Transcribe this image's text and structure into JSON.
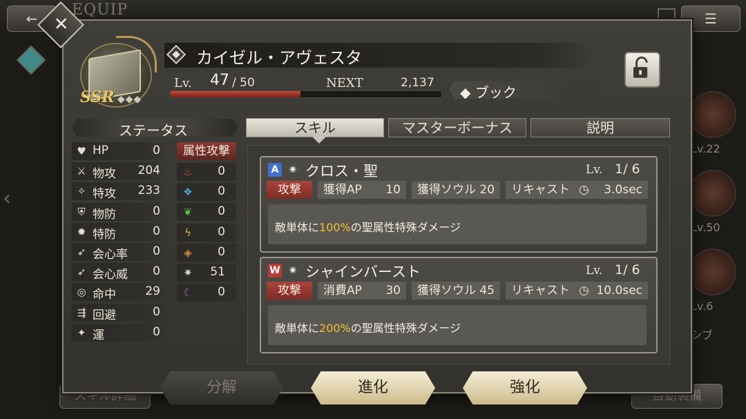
{
  "background": {
    "screen_title": "EQUIP",
    "side_texts": [
      "Lv.22",
      "Lv.50",
      "Lv.6",
      "シブ"
    ],
    "bottom_left_button": "スキル詳細",
    "bottom_right_button": "自動装備"
  },
  "header": {
    "name": "カイゼル・アヴェスタ",
    "rarity": "SSR",
    "rarity_dots": "◆◆◆",
    "level_label": "Lv.",
    "level_current": "47",
    "level_max": "/ 50",
    "next_label": "NEXT",
    "next_value": "2,137",
    "xp_fraction": 0.48,
    "equip_type": "◆ ブック"
  },
  "status": {
    "title": "ステータス",
    "stats": [
      {
        "icon": "heart-icon",
        "glyph": "♥",
        "label": "HP",
        "value": "0"
      },
      {
        "icon": "sword-icon",
        "glyph": "⚔",
        "label": "物攻",
        "value": "204"
      },
      {
        "icon": "staff-icon",
        "glyph": "✧",
        "label": "特攻",
        "value": "233"
      },
      {
        "icon": "shield-icon",
        "glyph": "⛨",
        "label": "物防",
        "value": "0"
      },
      {
        "icon": "gear-shield-icon",
        "glyph": "✹",
        "label": "特防",
        "value": "0"
      },
      {
        "icon": "crit-rate-icon",
        "glyph": "➶",
        "label": "会心率",
        "value": "0"
      },
      {
        "icon": "crit-damage-icon",
        "glyph": "➶",
        "label": "会心威",
        "value": "0"
      },
      {
        "icon": "target-icon",
        "glyph": "◎",
        "label": "命中",
        "value": "29"
      },
      {
        "icon": "boot-icon",
        "glyph": "⇶",
        "label": "回避",
        "value": "0"
      },
      {
        "icon": "luck-icon",
        "glyph": "✦",
        "label": "運",
        "value": "0"
      }
    ],
    "element_title": "属性攻撃",
    "elements": [
      {
        "icon": "fire-icon",
        "glyph": "♨",
        "color": "#d9533b",
        "value": "0"
      },
      {
        "icon": "water-icon",
        "glyph": "❖",
        "color": "#4fa3d9",
        "value": "0"
      },
      {
        "icon": "wind-icon",
        "glyph": "❦",
        "color": "#5fbf4a",
        "value": "0"
      },
      {
        "icon": "thunder-icon",
        "glyph": "ϟ",
        "color": "#e0b43a",
        "value": "0"
      },
      {
        "icon": "earth-icon",
        "glyph": "◈",
        "color": "#d88a3c",
        "value": "0"
      },
      {
        "icon": "light-icon",
        "glyph": "✷",
        "color": "#d8e0e8",
        "value": "51"
      },
      {
        "icon": "dark-icon",
        "glyph": "☾",
        "color": "#9b6ad8",
        "value": "0"
      }
    ]
  },
  "tabs": [
    {
      "label": "スキル",
      "active": true
    },
    {
      "label": "マスターボーナス",
      "active": false
    },
    {
      "label": "説明",
      "active": false
    }
  ],
  "skills": [
    {
      "badge": "A",
      "badge_color": "#3f6fd0",
      "name": "クロス・聖",
      "lv_label": "Lv.",
      "lv_value": "1/  6",
      "type": "攻撃",
      "ap_label": "獲得AP",
      "ap_value": "10",
      "soul_label": "獲得ソウル",
      "soul_value": "20",
      "recast_label": "リキャスト",
      "recast_value": "3.0sec",
      "desc_pre": "敵単体に",
      "desc_hl": "100%",
      "desc_post": "の聖属性特殊ダメージ"
    },
    {
      "badge": "W",
      "badge_color": "#b83a3a",
      "name": "シャインバースト",
      "lv_label": "Lv.",
      "lv_value": "1/  6",
      "type": "攻撃",
      "ap_label": "消費AP",
      "ap_value": "30",
      "soul_label": "獲得ソウル",
      "soul_value": "45",
      "recast_label": "リキャスト",
      "recast_value": "10.0sec",
      "desc_pre": "敵単体に",
      "desc_hl": "200%",
      "desc_post": "の聖属性特殊ダメージ"
    }
  ],
  "actions": {
    "decompose": "分解",
    "evolve": "進化",
    "enhance": "強化"
  }
}
